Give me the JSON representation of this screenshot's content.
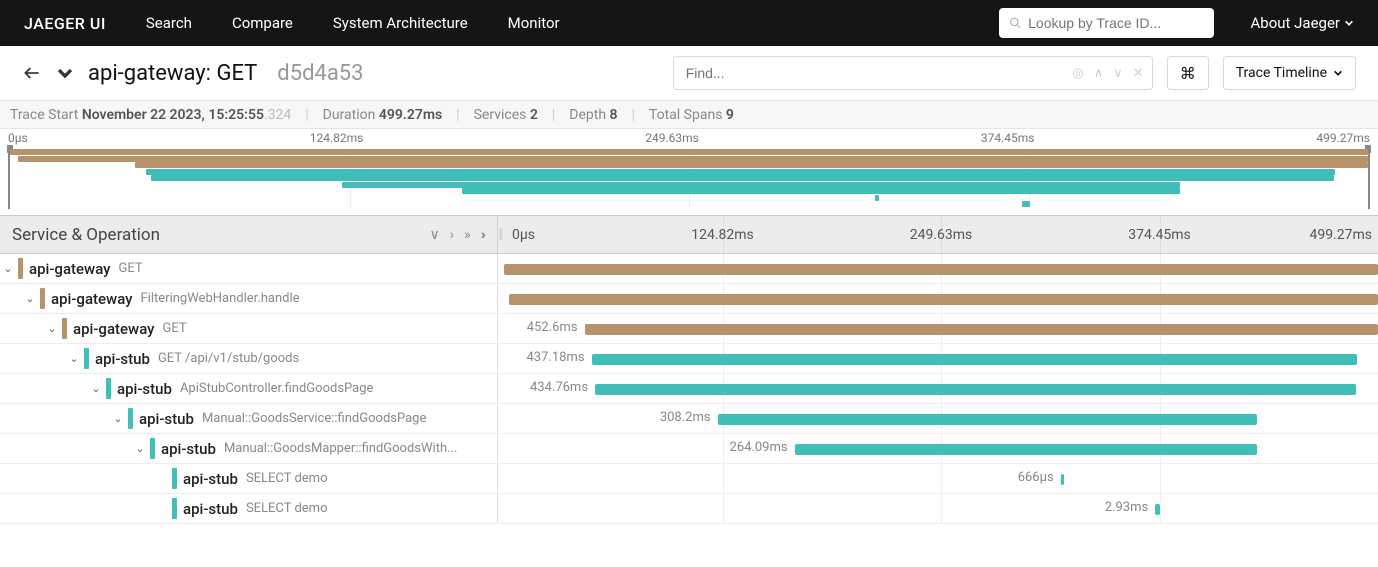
{
  "nav": {
    "brand": "JAEGER UI",
    "items": [
      "Search",
      "Compare",
      "System Architecture",
      "Monitor"
    ],
    "lookup_placeholder": "Lookup by Trace ID...",
    "about": "About Jaeger"
  },
  "header": {
    "trace_title": "api-gateway: GET",
    "trace_id": "d5d4a53",
    "find_placeholder": "Find...",
    "cmd_symbol": "⌘",
    "timeline_label": "Trace Timeline"
  },
  "stats": {
    "start_label": "Trace Start",
    "start_value": "November 22 2023, 15:25:55",
    "start_ms": ".324",
    "duration_label": "Duration",
    "duration_value": "499.27ms",
    "services_label": "Services",
    "services_value": "2",
    "depth_label": "Depth",
    "depth_value": "8",
    "spans_label": "Total Spans",
    "spans_value": "9"
  },
  "ticks": [
    "0µs",
    "124.82ms",
    "249.63ms",
    "374.45ms",
    "499.27ms"
  ],
  "service_op_header": "Service & Operation",
  "colors": {
    "api-gateway": "#b8926b",
    "api-stub": "#3fbfb7"
  },
  "total_ms": 499.27,
  "minimap": [
    {
      "start": 0,
      "end": 499.27,
      "color": "api-gateway"
    },
    {
      "start": 3,
      "end": 499.27,
      "color": "api-gateway"
    },
    {
      "start": 46,
      "end": 499.27,
      "color": "api-gateway"
    },
    {
      "start": 50,
      "end": 487.18,
      "color": "api-stub"
    },
    {
      "start": 52,
      "end": 486.76,
      "color": "api-stub"
    },
    {
      "start": 122,
      "end": 430.2,
      "color": "api-stub"
    },
    {
      "start": 166,
      "end": 430.09,
      "color": "api-stub"
    },
    {
      "start": 318,
      "end": 319,
      "color": "api-stub"
    },
    {
      "start": 372,
      "end": 375,
      "color": "api-stub"
    }
  ],
  "spans": [
    {
      "depth": 0,
      "service": "api-gateway",
      "op": "GET",
      "color": "api-gateway",
      "start": 0,
      "end": 499.27,
      "label": ""
    },
    {
      "depth": 1,
      "service": "api-gateway",
      "op": "FilteringWebHandler.handle",
      "color": "api-gateway",
      "start": 3,
      "end": 499.27,
      "label": ""
    },
    {
      "depth": 2,
      "service": "api-gateway",
      "op": "GET",
      "color": "api-gateway",
      "start": 46,
      "end": 499.27,
      "label": "452.6ms"
    },
    {
      "depth": 3,
      "service": "api-stub",
      "op": "GET /api/v1/stub/goods",
      "color": "api-stub",
      "start": 50,
      "end": 487.18,
      "label": "437.18ms"
    },
    {
      "depth": 4,
      "service": "api-stub",
      "op": "ApiStubController.findGoodsPage",
      "color": "api-stub",
      "start": 52,
      "end": 486.76,
      "label": "434.76ms"
    },
    {
      "depth": 5,
      "service": "api-stub",
      "op": "Manual::GoodsService::findGoodsPage",
      "color": "api-stub",
      "start": 122,
      "end": 430.2,
      "label": "308.2ms"
    },
    {
      "depth": 6,
      "service": "api-stub",
      "op": "Manual::GoodsMapper::findGoodsWith...",
      "color": "api-stub",
      "start": 166,
      "end": 430.09,
      "label": "264.09ms"
    },
    {
      "depth": 7,
      "service": "api-stub",
      "op": "SELECT demo",
      "color": "api-stub",
      "start": 318,
      "end": 319,
      "label": "666µs",
      "leaf": true
    },
    {
      "depth": 7,
      "service": "api-stub",
      "op": "SELECT demo",
      "color": "api-stub",
      "start": 372,
      "end": 375,
      "label": "2.93ms",
      "leaf": true
    }
  ]
}
